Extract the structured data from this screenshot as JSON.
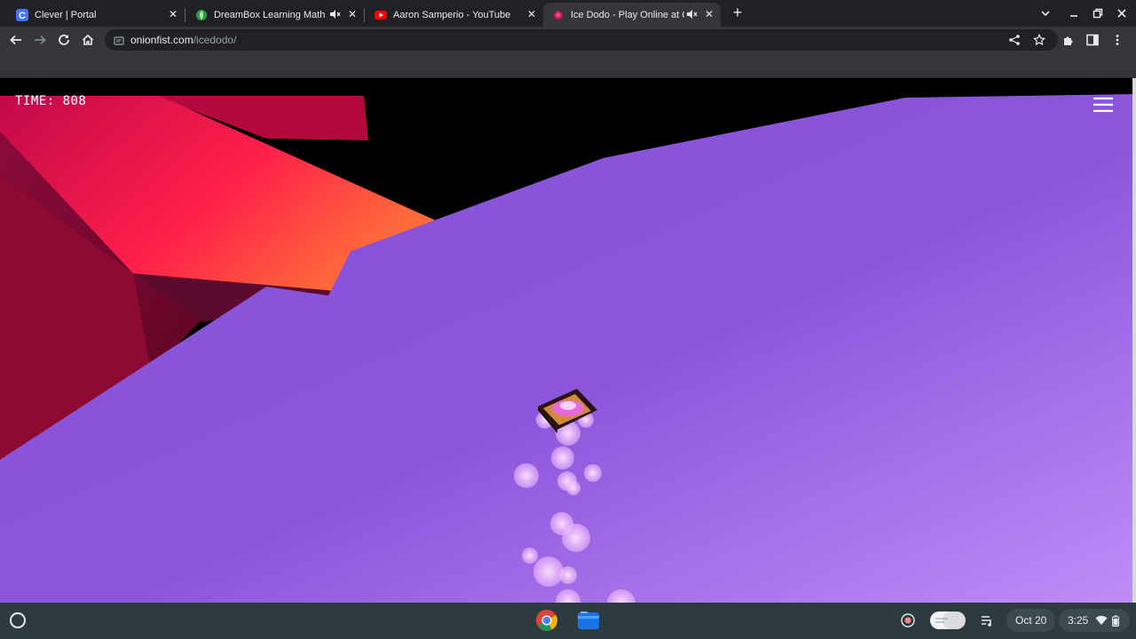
{
  "browser": {
    "tabs": [
      {
        "title": "Clever | Portal",
        "favicon": "clever-icon",
        "active": false,
        "muted": false
      },
      {
        "title": "DreamBox Learning Math",
        "favicon": "dreambox-icon",
        "active": false,
        "muted": true
      },
      {
        "title": "Aaron Samperio - YouTube",
        "favicon": "youtube-icon",
        "active": false,
        "muted": false
      },
      {
        "title": "Ice Dodo - Play Online at On",
        "favicon": "icedodo-icon",
        "active": true,
        "muted": true
      }
    ],
    "address": {
      "domain": "onionfist.com",
      "path": "/icedodo/"
    },
    "colors": {
      "tabstrip": "#202124",
      "toolbar": "#35363a",
      "text": "#e8eaed"
    }
  },
  "game": {
    "timer": "TIME: 808",
    "colors": {
      "floor": "#8b55d9",
      "floor_light": "#b98af5",
      "wall_red": "#e21247",
      "wall_dark": "#7a0828",
      "sky": "#000000"
    }
  },
  "shelf": {
    "date": "Oct 20",
    "time": "3:25",
    "apps": [
      "chrome-icon",
      "files-icon"
    ]
  }
}
